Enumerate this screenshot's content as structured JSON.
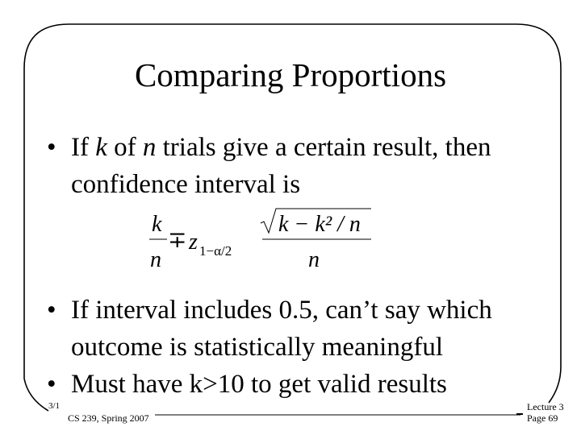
{
  "slide": {
    "title": "Comparing Proportions",
    "bullets": [
      {
        "marker": "•",
        "parts": [
          "If ",
          "k",
          " of ",
          "n",
          " trials give a certain result, then confidence interval is"
        ]
      },
      {
        "marker": "•",
        "text": "If interval includes 0.5, can’t say which outcome is statistically meaningful"
      },
      {
        "marker": "•",
        "text": "Must have k>10 to get valid results"
      }
    ],
    "formula": {
      "lhs_numerator": "k",
      "lhs_denominator": "n",
      "operator": "∓",
      "z": "z",
      "z_subscript": "1−α/2",
      "rhs_numerator": "k − k² / n",
      "rhs_denominator": "n",
      "latex": "\\frac{k}{n} \\mp z_{1-\\alpha/2} \\frac{\\sqrt{k - k^2/n}}{n}"
    }
  },
  "footer": {
    "date": "3/1",
    "course": "CS 239, Spring 2007",
    "lecture": "Lecture 3",
    "page": "Page 69"
  }
}
